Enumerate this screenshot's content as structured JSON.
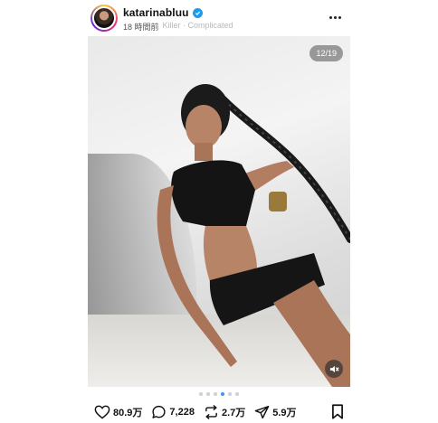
{
  "post": {
    "username": "katarinabluu",
    "time": "18 時間前",
    "music": "Killer · Complicated",
    "counter": "12/19",
    "dots_total": 7,
    "dots_active": 4
  },
  "actions": {
    "likes": "80.9万",
    "comments": "7,228",
    "reposts": "2.7万",
    "shares": "5.9万"
  },
  "icons": {
    "verified": "verified-badge-icon",
    "more": "more-options-icon",
    "mute": "muted-speaker-icon",
    "like": "heart-icon",
    "comment": "comment-bubble-icon",
    "repost": "repost-icon",
    "share": "paper-plane-icon",
    "save": "bookmark-icon"
  },
  "colors": {
    "verified": "#1d9bf0",
    "active_dot": "#3897f0"
  }
}
